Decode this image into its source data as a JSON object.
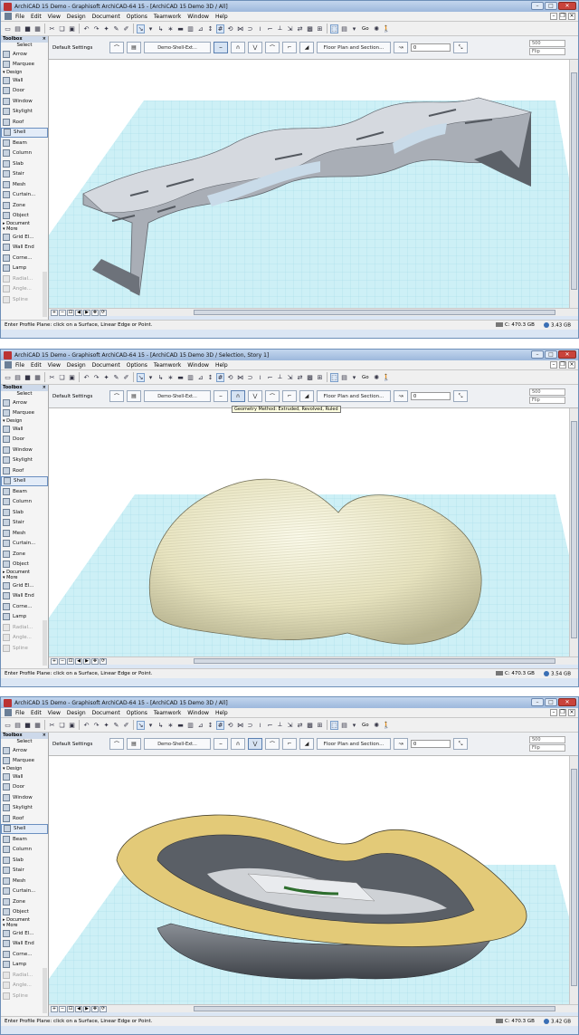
{
  "windows": [
    {
      "title": "ArchiCAD 15 Demo - Graphisoft ArchiCAD-64 15 - [ArchiCAD 15 Demo 3D / All]",
      "status_text": "Enter Profile Plane: click on a Surface, Linear Edge or Point.",
      "disk_free": "C: 470.3 GB",
      "memory": "3.43 GB",
      "shell_method_label": "Demo-Shell-Ext...",
      "tooltip": ""
    },
    {
      "title": "ArchiCAD 15 Demo - Graphisoft ArchiCAD-64 15 - [ArchiCAD 15 Demo 3D / Selection, Story 1]",
      "status_text": "Enter Profile Plane: click on a Surface, Linear Edge or Point.",
      "disk_free": "C: 470.3 GB",
      "memory": "3.54 GB",
      "shell_method_label": "Demo-Shell-Ext...",
      "tooltip": "Geometry Method: Extruded, Revolved, Ruled"
    },
    {
      "title": "ArchiCAD 15 Demo - Graphisoft ArchiCAD-64 15 - [ArchiCAD 15 Demo 3D / All]",
      "status_text": "Enter Profile Plane: click on a Surface, Linear Edge or Point.",
      "disk_free": "C: 470.3 GB",
      "memory": "3.42 GB",
      "shell_method_label": "Demo-Shell-Ext...",
      "tooltip": ""
    }
  ],
  "menu": [
    "File",
    "Edit",
    "View",
    "Design",
    "Document",
    "Options",
    "Teamwork",
    "Window",
    "Help"
  ],
  "toolbar": {
    "go_label": "Go"
  },
  "infobox": {
    "default_settings": "Default Settings",
    "floor_plan_button": "Floor Plan and Section...",
    "elevation_value": "0",
    "thickness_value": "500",
    "flip_label": "Flip"
  },
  "toolbox": {
    "title": "Toolbox",
    "select_label": "Select",
    "arrow_label": "Arrow",
    "marquee_label": "Marquee",
    "design_group": "Design",
    "design_tools": [
      "Wall",
      "Door",
      "Window",
      "Skylight",
      "Roof",
      "Shell",
      "Beam",
      "Column",
      "Slab",
      "Stair",
      "Mesh",
      "Curtain...",
      "Zone",
      "Object"
    ],
    "document_group": "Document",
    "more_group": "More",
    "more_tools": [
      "Grid El...",
      "Wall End",
      "Corne...",
      "Lamp",
      "Radial...",
      "Angle...",
      "Spline"
    ]
  },
  "colors": {
    "grid_fill": "#cdf0f6",
    "grid_line": "#9fd8e6",
    "shell_gray": "#a9aeb6",
    "dome_cream": "#efeccb",
    "rim_yellow": "#e3ca78"
  }
}
